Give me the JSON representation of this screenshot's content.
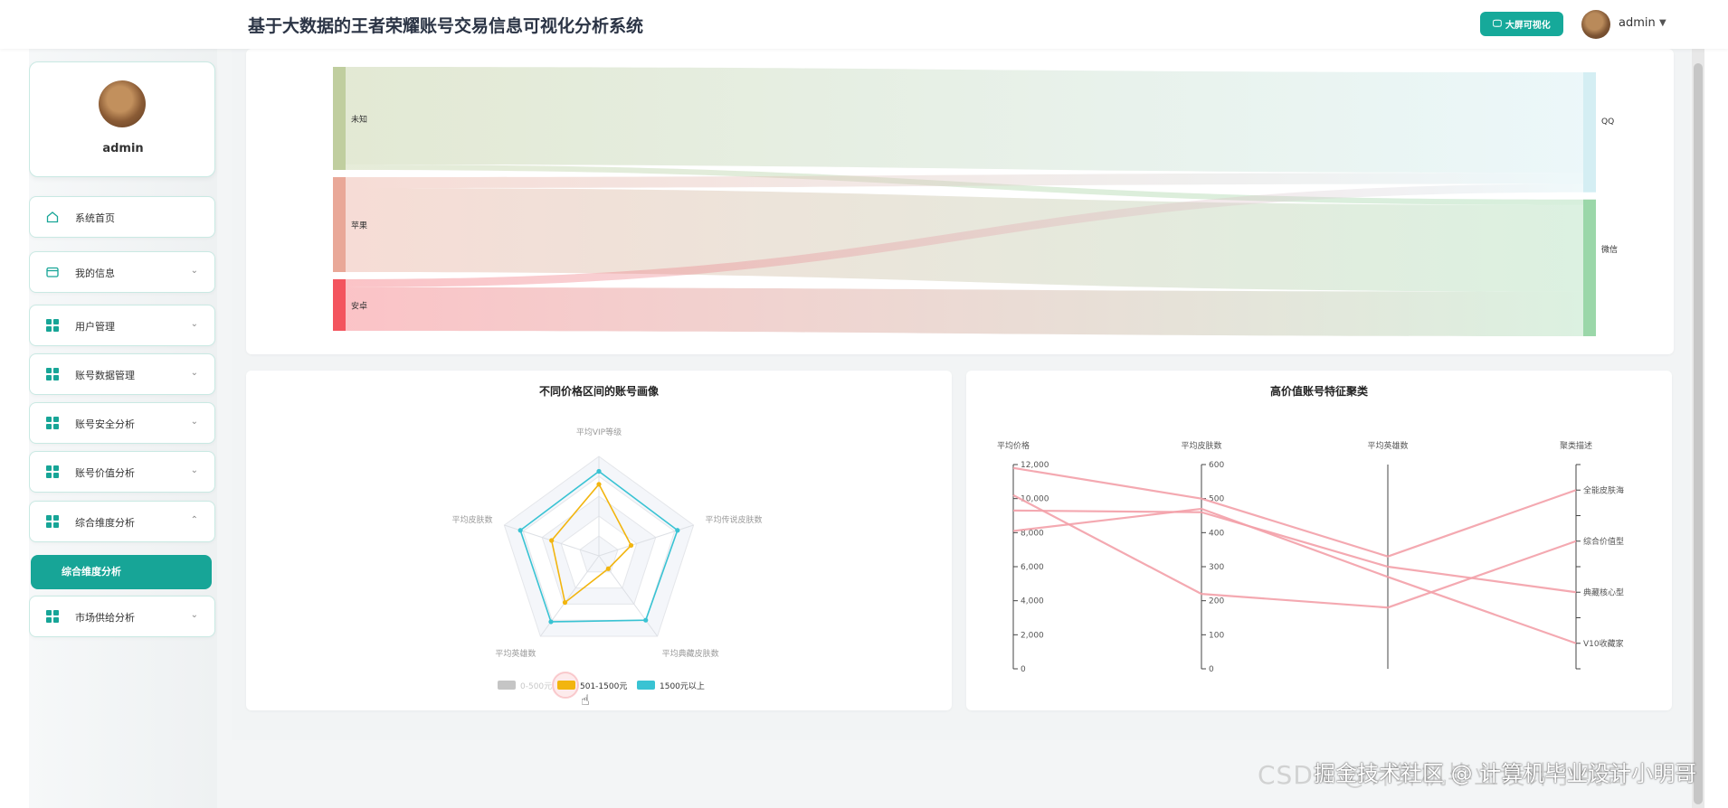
{
  "header": {
    "title": "基于大数据的王者荣耀账号交易信息可视化分析系统",
    "bigscreen_label": "大屏可视化",
    "username": "admin"
  },
  "sidebar": {
    "profile_name": "admin",
    "items": [
      {
        "label": "系统首页",
        "icon": "home-icon",
        "chevron": ""
      },
      {
        "label": "我的信息",
        "icon": "card-icon",
        "chevron": "⌄"
      },
      {
        "label": "用户管理",
        "icon": "grid-icon",
        "chevron": "⌄"
      },
      {
        "label": "账号数据管理",
        "icon": "grid-icon",
        "chevron": "⌄"
      },
      {
        "label": "账号安全分析",
        "icon": "grid-icon",
        "chevron": "⌄"
      },
      {
        "label": "账号价值分析",
        "icon": "grid-icon",
        "chevron": "⌄"
      },
      {
        "label": "综合维度分析",
        "icon": "grid-icon",
        "chevron": "⌃"
      },
      {
        "label": "市场供给分析",
        "icon": "grid-icon",
        "chevron": "⌄"
      }
    ],
    "active_sub": "综合维度分析"
  },
  "colors": {
    "accent": "#17a597",
    "sankey_unknown": "#c0ce9f",
    "sankey_apple": "#e9a898",
    "sankey_android": "#f3545e",
    "sankey_qq": "#d4eef3",
    "sankey_wechat": "#9bd7a9",
    "radar_mid": "#f2b50f",
    "radar_high": "#39c3d3",
    "radar_low": "#c5c5c5",
    "parallel_line": "#f3a0a8"
  },
  "chart_data": [
    {
      "type": "sankey",
      "title": "",
      "sources": [
        "未知",
        "苹果",
        "安卓"
      ],
      "targets": [
        "QQ",
        "微信"
      ],
      "links": [
        {
          "source": "未知",
          "target": "QQ",
          "value": 36
        },
        {
          "source": "未知",
          "target": "微信",
          "value": 2
        },
        {
          "source": "苹果",
          "target": "QQ",
          "value": 4
        },
        {
          "source": "苹果",
          "target": "微信",
          "value": 31
        },
        {
          "source": "安卓",
          "target": "QQ",
          "value": 3
        },
        {
          "source": "安卓",
          "target": "微信",
          "value": 16
        }
      ]
    },
    {
      "type": "radar",
      "title": "不同价格区间的账号画像",
      "indicators": [
        "平均VIP等级",
        "平均传说皮肤数",
        "平均典藏皮肤数",
        "平均英雄数",
        "平均皮肤数"
      ],
      "series": [
        {
          "name": "0-500元",
          "values": [
            0.0,
            0.0,
            0.0,
            0.0,
            0.0
          ]
        },
        {
          "name": "501-1500元",
          "values": [
            0.72,
            0.34,
            0.16,
            0.58,
            0.5
          ]
        },
        {
          "name": "1500元以上",
          "values": [
            0.85,
            0.83,
            0.8,
            0.82,
            0.83
          ]
        }
      ],
      "legend": [
        "0-500元",
        "501-1500元",
        "1500元以上"
      ],
      "legend_position": "bottom"
    },
    {
      "type": "parallel",
      "title": "高价值账号特征聚类",
      "axes": [
        {
          "name": "平均价格",
          "ticks": [
            "0",
            "2,000",
            "4,000",
            "6,000",
            "8,000",
            "10,000",
            "12,000"
          ],
          "range": [
            0,
            12000
          ]
        },
        {
          "name": "平均皮肤数",
          "ticks": [
            "0",
            "100",
            "200",
            "300",
            "400",
            "500",
            "600"
          ],
          "range": [
            0,
            600
          ]
        },
        {
          "name": "平均英雄数",
          "ticks": [],
          "range": [
            0,
            1
          ]
        },
        {
          "name": "聚类描述",
          "categories": [
            "V10收藏家",
            "典藏核心型",
            "综合价值型",
            "全能皮肤海"
          ]
        }
      ],
      "lines": [
        {
          "values": [
            11800,
            500,
            0.55,
            "全能皮肤海"
          ]
        },
        {
          "values": [
            10200,
            220,
            0.3,
            "综合价值型"
          ]
        },
        {
          "values": [
            9300,
            460,
            0.5,
            "典藏核心型"
          ]
        },
        {
          "values": [
            8100,
            470,
            0.45,
            "V10收藏家"
          ]
        }
      ]
    }
  ],
  "watermark": "掘金技术社区 @ 计算机毕业设计小明哥",
  "watermark_back": "CSDN @计算机毕业设计小明哥"
}
